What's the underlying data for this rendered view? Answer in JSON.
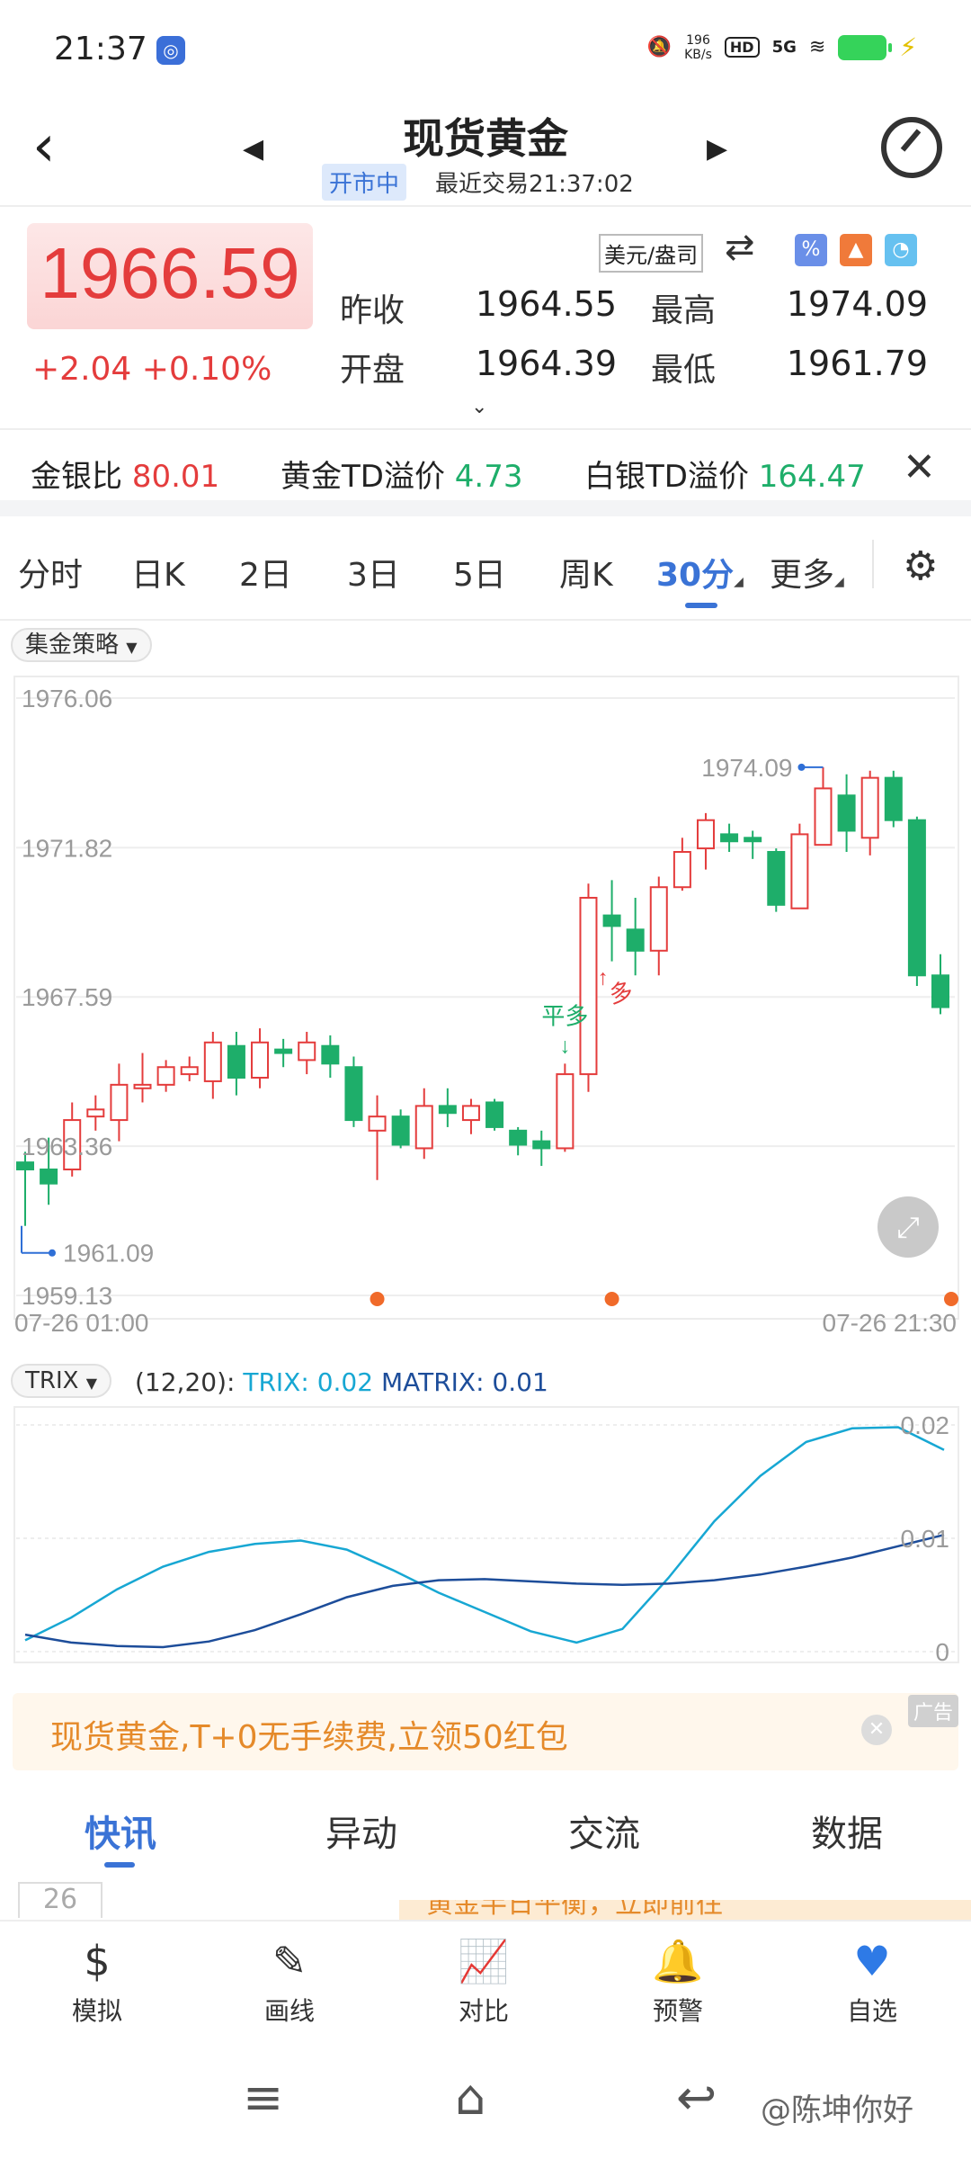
{
  "status_bar": {
    "time": "21:37",
    "net_speed_value": "196",
    "net_speed_unit": "KB/s",
    "hd": "HD",
    "signal": "5G",
    "app_icon": "quote-app-icon"
  },
  "header": {
    "title": "现货黄金",
    "market_status": "开市中",
    "last_trade": "最近交易21:37:02"
  },
  "quote": {
    "price": "1966.59",
    "change": "+2.04 +0.10%",
    "unit": "美元/盎司",
    "stats": {
      "prev_close_label": "昨收",
      "prev_close": "1964.55",
      "high_label": "最高",
      "high": "1974.09",
      "open_label": "开盘",
      "open": "1964.39",
      "low_label": "最低",
      "low": "1961.79"
    },
    "colors": {
      "up": "#e43c3c",
      "down": "#1eae6a",
      "accent": "#3a73d6"
    }
  },
  "ratios": {
    "gold_silver_label": "金银比",
    "gold_silver": "80.01",
    "gold_td_label": "黄金TD溢价",
    "gold_td": "4.73",
    "silver_td_label": "白银TD溢价",
    "silver_td": "164.47"
  },
  "period_tabs": [
    "分时",
    "日K",
    "2日",
    "3日",
    "5日",
    "周K",
    "30分",
    "更多"
  ],
  "active_period": "30分",
  "strategy_chip": "集金策略",
  "kline": {
    "y_labels": [
      "1976.06",
      "1971.82",
      "1967.59",
      "1963.36",
      "1959.13"
    ],
    "high_marker": "1974.09",
    "low_marker": "1961.09",
    "start_time": "07-26 01:00",
    "end_time": "07-26 21:30",
    "signal_close_long": "平多",
    "signal_long": "多"
  },
  "indicator": {
    "name": "TRIX",
    "params": "(12,20):",
    "trix_label": "TRIX: 0.02",
    "matrix_label": "MATRIX: 0.01",
    "y_labels": [
      "0.02",
      "0.01",
      "0"
    ]
  },
  "ad": {
    "text": "现货黄金,T+0无手续费,立领50红包",
    "tag": "广告"
  },
  "news_tabs": [
    "快讯",
    "异动",
    "交流",
    "数据"
  ],
  "news_date": "26",
  "news_peek": "黄金半日平衡，立即前往",
  "bottom_nav": [
    {
      "label": "模拟",
      "icon": "simulate-icon"
    },
    {
      "label": "画线",
      "icon": "draw-line-icon"
    },
    {
      "label": "对比",
      "icon": "compare-icon"
    },
    {
      "label": "预警",
      "icon": "alarm-icon"
    },
    {
      "label": "自选",
      "icon": "heart-icon"
    }
  ],
  "watermark": "@陈坤你好",
  "chart_data": [
    {
      "type": "candlestick",
      "title": "",
      "ylim": [
        1959.13,
        1976.06
      ],
      "y_ticks": [
        1976.06,
        1971.82,
        1967.59,
        1963.36,
        1959.13
      ],
      "x_range": [
        "07-26 01:00",
        "07-26 21:30"
      ],
      "candles": [
        {
          "o": 1962.9,
          "c": 1962.7,
          "h": 1963.2,
          "l": 1961.1
        },
        {
          "o": 1962.7,
          "c": 1962.3,
          "h": 1963.6,
          "l": 1961.7
        },
        {
          "o": 1962.7,
          "c": 1964.1,
          "h": 1964.6,
          "l": 1962.5
        },
        {
          "o": 1964.2,
          "c": 1964.4,
          "h": 1964.8,
          "l": 1963.8
        },
        {
          "o": 1964.1,
          "c": 1965.1,
          "h": 1965.7,
          "l": 1963.5
        },
        {
          "o": 1965.0,
          "c": 1965.1,
          "h": 1966.0,
          "l": 1964.6
        },
        {
          "o": 1965.1,
          "c": 1965.6,
          "h": 1965.8,
          "l": 1964.9
        },
        {
          "o": 1965.4,
          "c": 1965.6,
          "h": 1965.9,
          "l": 1965.2
        },
        {
          "o": 1965.2,
          "c": 1966.3,
          "h": 1966.6,
          "l": 1964.7
        },
        {
          "o": 1966.2,
          "c": 1965.3,
          "h": 1966.6,
          "l": 1964.8
        },
        {
          "o": 1965.3,
          "c": 1966.3,
          "h": 1966.7,
          "l": 1965.0
        },
        {
          "o": 1966.1,
          "c": 1966.0,
          "h": 1966.4,
          "l": 1965.6
        },
        {
          "o": 1965.8,
          "c": 1966.3,
          "h": 1966.6,
          "l": 1965.4
        },
        {
          "o": 1966.2,
          "c": 1965.7,
          "h": 1966.5,
          "l": 1965.3
        },
        {
          "o": 1965.6,
          "c": 1964.1,
          "h": 1965.9,
          "l": 1963.9
        },
        {
          "o": 1963.8,
          "c": 1964.2,
          "h": 1964.8,
          "l": 1962.4
        },
        {
          "o": 1964.2,
          "c": 1963.4,
          "h": 1964.4,
          "l": 1963.3
        },
        {
          "o": 1963.3,
          "c": 1964.5,
          "h": 1965.0,
          "l": 1963.0
        },
        {
          "o": 1964.5,
          "c": 1964.3,
          "h": 1965.0,
          "l": 1963.9
        },
        {
          "o": 1964.1,
          "c": 1964.5,
          "h": 1964.7,
          "l": 1963.7
        },
        {
          "o": 1964.6,
          "c": 1963.9,
          "h": 1964.7,
          "l": 1963.8
        },
        {
          "o": 1963.8,
          "c": 1963.4,
          "h": 1963.9,
          "l": 1963.1
        },
        {
          "o": 1963.5,
          "c": 1963.3,
          "h": 1963.8,
          "l": 1962.8
        },
        {
          "o": 1963.3,
          "c": 1965.4,
          "h": 1965.7,
          "l": 1963.2
        },
        {
          "o": 1965.4,
          "c": 1970.4,
          "h": 1970.8,
          "l": 1964.9
        },
        {
          "o": 1969.9,
          "c": 1969.6,
          "h": 1970.9,
          "l": 1968.6
        },
        {
          "o": 1969.5,
          "c": 1968.9,
          "h": 1970.4,
          "l": 1968.2
        },
        {
          "o": 1968.9,
          "c": 1970.7,
          "h": 1971.0,
          "l": 1968.2
        },
        {
          "o": 1970.7,
          "c": 1971.7,
          "h": 1972.1,
          "l": 1970.6
        },
        {
          "o": 1971.8,
          "c": 1972.6,
          "h": 1972.8,
          "l": 1971.2
        },
        {
          "o": 1972.2,
          "c": 1972.0,
          "h": 1972.5,
          "l": 1971.7
        },
        {
          "o": 1972.1,
          "c": 1972.0,
          "h": 1972.3,
          "l": 1971.5
        },
        {
          "o": 1971.7,
          "c": 1970.2,
          "h": 1971.8,
          "l": 1970.0
        },
        {
          "o": 1970.1,
          "c": 1972.2,
          "h": 1972.5,
          "l": 1970.1
        },
        {
          "o": 1971.9,
          "c": 1973.5,
          "h": 1974.1,
          "l": 1971.9
        },
        {
          "o": 1973.3,
          "c": 1972.3,
          "h": 1973.9,
          "l": 1971.7
        },
        {
          "o": 1972.1,
          "c": 1973.8,
          "h": 1974.0,
          "l": 1971.6
        },
        {
          "o": 1973.8,
          "c": 1972.6,
          "h": 1974.0,
          "l": 1972.4
        },
        {
          "o": 1972.6,
          "c": 1968.2,
          "h": 1972.7,
          "l": 1967.9
        },
        {
          "o": 1968.2,
          "c": 1967.3,
          "h": 1968.8,
          "l": 1967.1
        }
      ]
    },
    {
      "type": "line",
      "title": "TRIX",
      "ylim": [
        0,
        0.02
      ],
      "y_ticks": [
        0.02,
        0.01,
        0
      ],
      "series": [
        {
          "name": "TRIX",
          "color": "#17a7d3",
          "values": [
            0.001,
            0.003,
            0.0055,
            0.0075,
            0.0088,
            0.0095,
            0.0098,
            0.009,
            0.0072,
            0.0052,
            0.0035,
            0.0018,
            0.0008,
            0.002,
            0.0065,
            0.0115,
            0.0155,
            0.0185,
            0.0197,
            0.0198,
            0.0178
          ]
        },
        {
          "name": "MATRIX",
          "color": "#1d4d9a",
          "values": [
            0.0015,
            0.0008,
            0.0005,
            0.0004,
            0.0009,
            0.0019,
            0.0033,
            0.0048,
            0.0058,
            0.0063,
            0.0064,
            0.0062,
            0.006,
            0.0059,
            0.006,
            0.0063,
            0.0068,
            0.0075,
            0.0083,
            0.0093,
            0.0103
          ]
        }
      ]
    }
  ]
}
